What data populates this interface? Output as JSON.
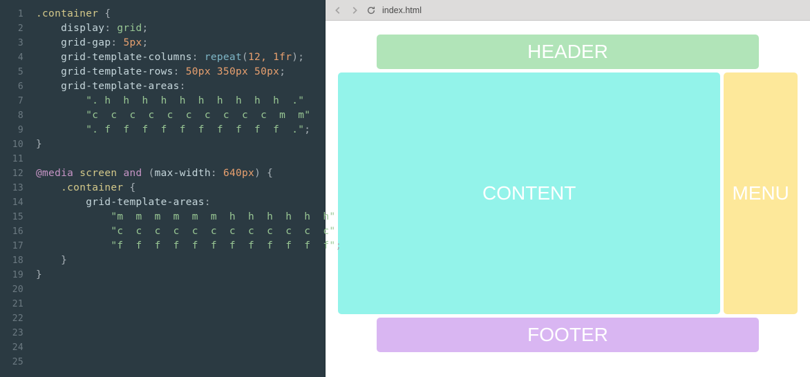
{
  "browser": {
    "address": "index.html"
  },
  "layout": {
    "header_label": "HEADER",
    "content_label": "CONTENT",
    "menu_label": "MENU",
    "footer_label": "FOOTER"
  },
  "css_source": {
    "selector_container": ".container",
    "decl_display": {
      "prop": "display",
      "value": "grid"
    },
    "decl_gap": {
      "prop": "grid-gap",
      "value": "5px"
    },
    "decl_cols": {
      "prop": "grid-template-columns",
      "fn": "repeat",
      "args": "12, 1fr"
    },
    "decl_rows": {
      "prop": "grid-template-rows",
      "values": "50px 350px 50px"
    },
    "decl_areas_prop": "grid-template-areas",
    "areas": [
      "\". h  h  h  h  h  h  h  h  h  h  .\"",
      "\"c  c  c  c  c  c  c  c  c  c  m  m\"",
      "\". f  f  f  f  f  f  f  f  f  f  .\""
    ],
    "media_rule": "@media screen and (max-width: 640px)",
    "media_areas": [
      "\"m  m  m  m  m  m  h  h  h  h  h  h\"",
      "\"c  c  c  c  c  c  c  c  c  c  c  c\"",
      "\"f  f  f  f  f  f  f  f  f  f  f  f\""
    ]
  },
  "line_numbers": [
    "1",
    "2",
    "3",
    "4",
    "5",
    "6",
    "7",
    "8",
    "9",
    "10",
    "11",
    "12",
    "13",
    "14",
    "15",
    "16",
    "17",
    "18",
    "19",
    "20",
    "21",
    "22",
    "23",
    "24",
    "25"
  ]
}
